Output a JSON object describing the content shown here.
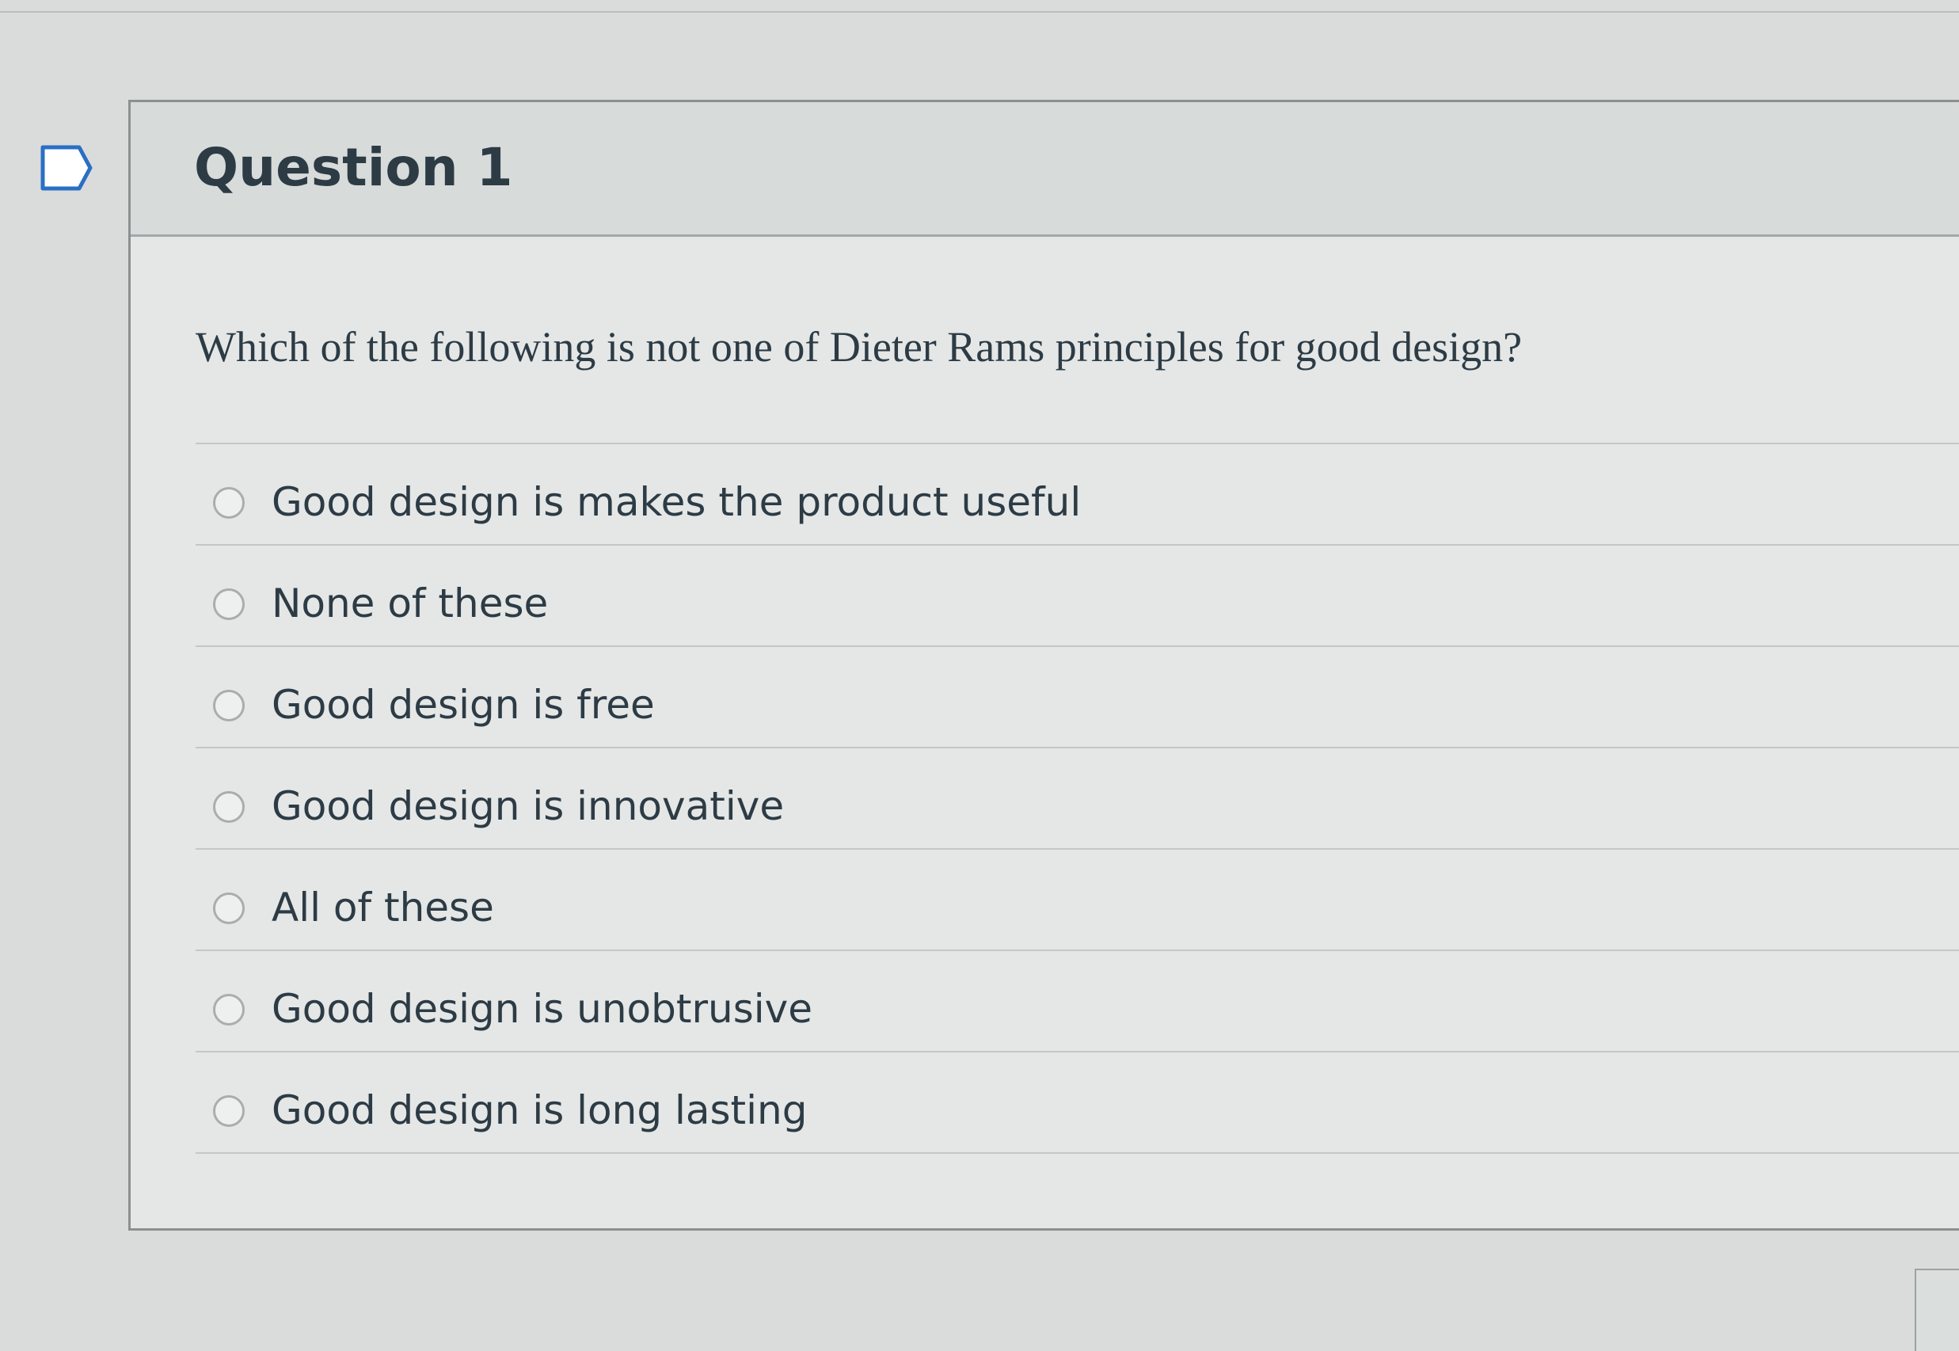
{
  "question": {
    "title": "Question 1",
    "prompt": "Which of the following is not one of Dieter Rams principles for good design?",
    "flag_icon": "flag-outline-icon"
  },
  "answers": [
    {
      "label": "Good design is makes the product useful",
      "selected": false
    },
    {
      "label": "None of these",
      "selected": false
    },
    {
      "label": "Good design is free",
      "selected": false
    },
    {
      "label": "Good design is innovative",
      "selected": false
    },
    {
      "label": "All of these",
      "selected": false
    },
    {
      "label": "Good design is unobtrusive",
      "selected": false
    },
    {
      "label": "Good design is long lasting",
      "selected": false
    }
  ],
  "colors": {
    "background": "#d9dcdb",
    "card": "#e4e7e6",
    "header": "#d7dbda",
    "text": "#2d3b45",
    "border": "#8b9090"
  }
}
